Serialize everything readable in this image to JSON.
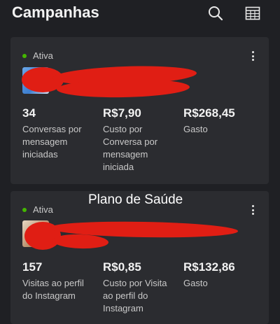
{
  "header": {
    "title": "Campanhas"
  },
  "overlay_label": "Plano de Saúde",
  "campaigns": [
    {
      "status": "Ativa",
      "metrics": [
        {
          "value": "34",
          "label": "Conversas por mensagem iniciadas"
        },
        {
          "value": "R$7,90",
          "label": "Custo por Conversa por mensagem iniciada"
        },
        {
          "value": "R$268,45",
          "label": "Gasto"
        }
      ]
    },
    {
      "status": "Ativa",
      "metrics": [
        {
          "value": "157",
          "label": "Visitas ao perfil do Instagram"
        },
        {
          "value": "R$0,85",
          "label": "Custo por Visita ao perfil do Instagram"
        },
        {
          "value": "R$132,86",
          "label": "Gasto"
        }
      ]
    }
  ],
  "colors": {
    "status_active": "#44b700",
    "redaction": "#e01e14",
    "background": "#1f2024",
    "card": "#2b2c30"
  }
}
